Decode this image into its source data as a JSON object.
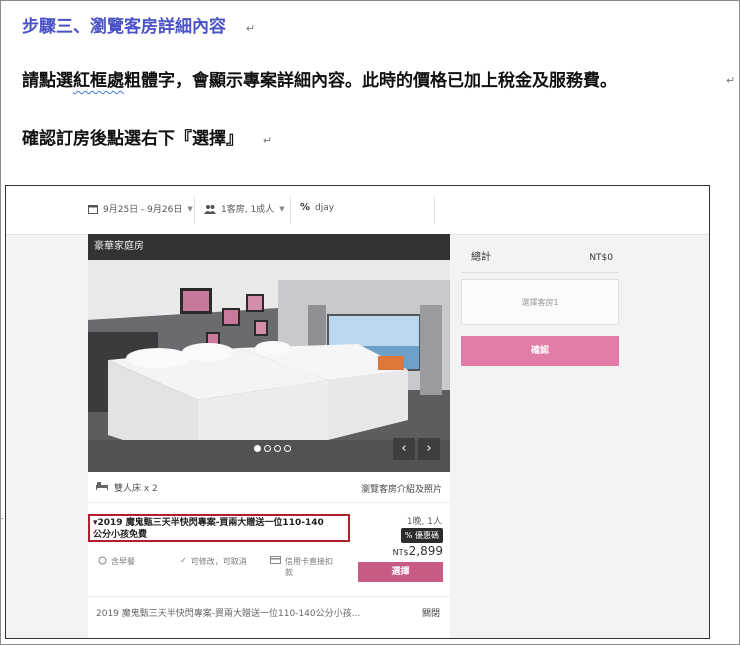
{
  "doc": {
    "step_title": "步驟三、瀏覽客房詳細內容",
    "para1_a": "請點選",
    "para1_b": "紅框處",
    "para1_c": "粗體字，會顯示專案詳細內容。此時的價格已加上稅金及服務費。",
    "para2": "確認訂房後點選右下『選擇』",
    "paragraph_mark": "↵"
  },
  "topbar": {
    "dates": "9月25日 - 9月26日",
    "guests": "1客房, 1成人",
    "promo_code": "djay"
  },
  "room": {
    "name": "豪華家庭房",
    "bed": "雙人床 x 2",
    "gallery_link": "瀏覽客房介紹及照片",
    "carousel": {
      "total_dots": 4,
      "active_index": 0
    }
  },
  "plan": {
    "title_line1": "▾2019 魔鬼甄三天半快閃專案-買兩大贈送一位110-140",
    "title_line2": "公分小孩免費",
    "occupancy": "1晚, 1人",
    "meal": "含早餐",
    "cancel": "可修改，可取消",
    "payment": "信用卡直接扣款",
    "code_badge": "優惠碼",
    "currency": "NT$",
    "price": "2,899",
    "select_label": "選擇"
  },
  "plan2": {
    "title": "2019 魔鬼甄三天半快閃專案-買兩大贈送一位110-140公分小孩...",
    "toggle": "關閉"
  },
  "summary": {
    "label": "總計",
    "amount": "NT$0",
    "room_select": "選擇客房1",
    "confirm": "確認"
  },
  "colors": {
    "step_title": "#4a52c7",
    "highlight_border": "#b41e2a",
    "select_button": "#c95a86",
    "confirm_button": "#e07ca5"
  }
}
